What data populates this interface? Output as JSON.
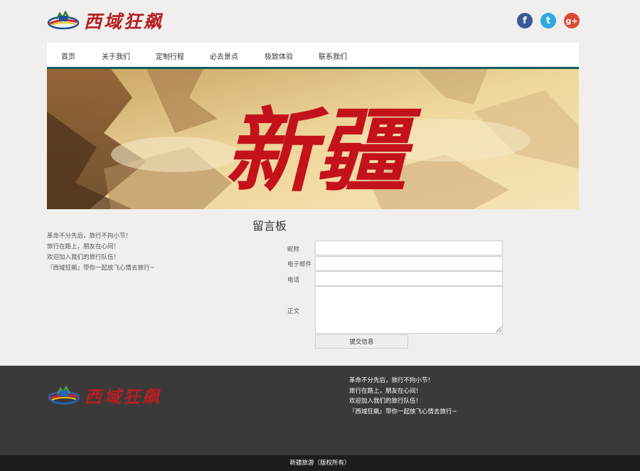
{
  "header": {
    "logo_text": "西域狂飙",
    "social": [
      {
        "icon": "facebook-icon",
        "glyph": "f",
        "color": "#3b5998"
      },
      {
        "icon": "twitter-icon",
        "glyph": "t",
        "color": "#2fa8df"
      },
      {
        "icon": "google-plus-icon",
        "glyph": "g+",
        "color": "#dc4a38"
      }
    ]
  },
  "nav": {
    "items": [
      {
        "label": "首页"
      },
      {
        "label": "关于我们"
      },
      {
        "label": "定制行程"
      },
      {
        "label": "必去景点"
      },
      {
        "label": "极致体验"
      },
      {
        "label": "联系我们"
      }
    ]
  },
  "banner": {
    "calligraphy": "新疆"
  },
  "board": {
    "title": "留言板",
    "intro_lines": [
      "革命不分先后，旅行不拘小节！",
      "旅行在路上，朋友在心间！",
      "欢迎加入我们的旅行队伍！",
      "『西域狂飙』带你一起放飞心情去旅行~"
    ],
    "fields": {
      "nickname_label": "昵称",
      "email_label": "电子邮件",
      "phone_label": "电话",
      "body_label": "正文"
    },
    "submit_label": "提交信息"
  },
  "footer": {
    "logo_text": "西域狂飙",
    "lines": [
      "革命不分先后，旅行不拘小节！",
      "旅行在路上，朋友在心间！",
      "欢迎加入我们的旅行队伍！",
      "『西域狂飙』带你一起放飞心情去旅行~"
    ],
    "copyright": "新疆旅游（版权所有）"
  },
  "colors": {
    "nav_line": "#0e5f5c",
    "brand_red": "#b41e22",
    "footer_bg": "#3a3a3a",
    "copyright_bg": "#1d1d1d"
  }
}
